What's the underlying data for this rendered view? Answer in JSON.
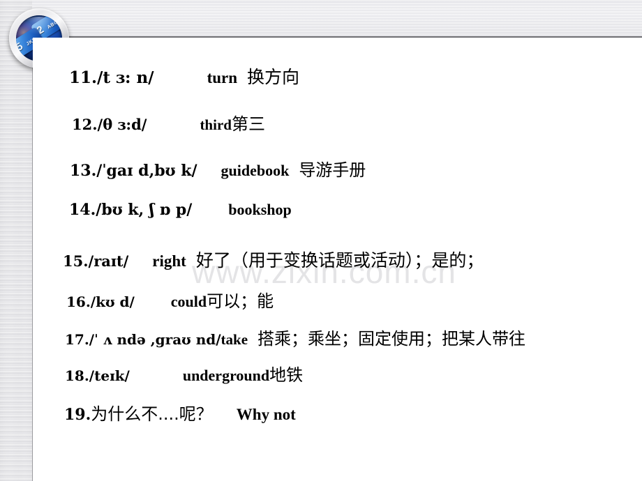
{
  "slide": {
    "background_color": "#ffffff",
    "metal_color": "#e3e3e6",
    "accent_rule_color": "#6e6e72",
    "watermark": "www.zixin.com.cn",
    "watermark_color": "#e4e4e6"
  },
  "logo": {
    "name": "phone-keypad-badge",
    "key_top_digit": "2",
    "key_top_letters": "ABC",
    "key_bottom_digit": "5",
    "key_bottom_letters": "JKL"
  },
  "vocabulary": [
    {
      "number": "11.",
      "ipa": "/t ɜ: n/",
      "english": "turn",
      "chinese": "换方向",
      "ipa_size": 23,
      "word_size": 23,
      "chinese_size": 25
    },
    {
      "number": "12.",
      "ipa": "/θ ɜ:d/",
      "english": "third",
      "chinese": "第三",
      "ipa_size": 21,
      "word_size": 21,
      "chinese_size": 24
    },
    {
      "number": "13.",
      "ipa": "/ˈgaɪ d,bʊ k/",
      "english": "guidebook",
      "chinese": "导游手册",
      "ipa_size": 22,
      "word_size": 22,
      "chinese_size": 24
    },
    {
      "number": "14.",
      "ipa": "/bʊ k, ʃ ɒ p/",
      "english": "bookshop",
      "chinese": "",
      "ipa_size": 22,
      "word_size": 22,
      "chinese_size": 24
    },
    {
      "number": "15.",
      "ipa": "/raɪt/",
      "english": "right",
      "chinese": "好了（用于变换话题或活动）；是的；",
      "ipa_size": 21,
      "word_size": 23,
      "chinese_size": 25
    },
    {
      "number": "16.",
      "ipa": "/kʊ d/",
      "english": "could",
      "chinese": "可以；能",
      "ipa_size": 20,
      "word_size": 22,
      "chinese_size": 24
    },
    {
      "number": "17.",
      "ipa": "/ˈ ʌ ndə ,graʊ nd/",
      "english": "take",
      "chinese": "搭乘；乘坐；固定使用；把某人带往",
      "ipa_size": 20,
      "word_size": 21,
      "chinese_size": 24
    },
    {
      "number": "18.",
      "ipa": "/teɪk/",
      "english": "underground",
      "chinese": "地铁",
      "ipa_size": 20,
      "word_size": 22,
      "chinese_size": 24
    },
    {
      "number": "19.",
      "ipa": "为什么不....呢？",
      "english": "Why not",
      "chinese": "",
      "ipa_size": 22,
      "word_size": 23,
      "chinese_size": 24
    }
  ]
}
